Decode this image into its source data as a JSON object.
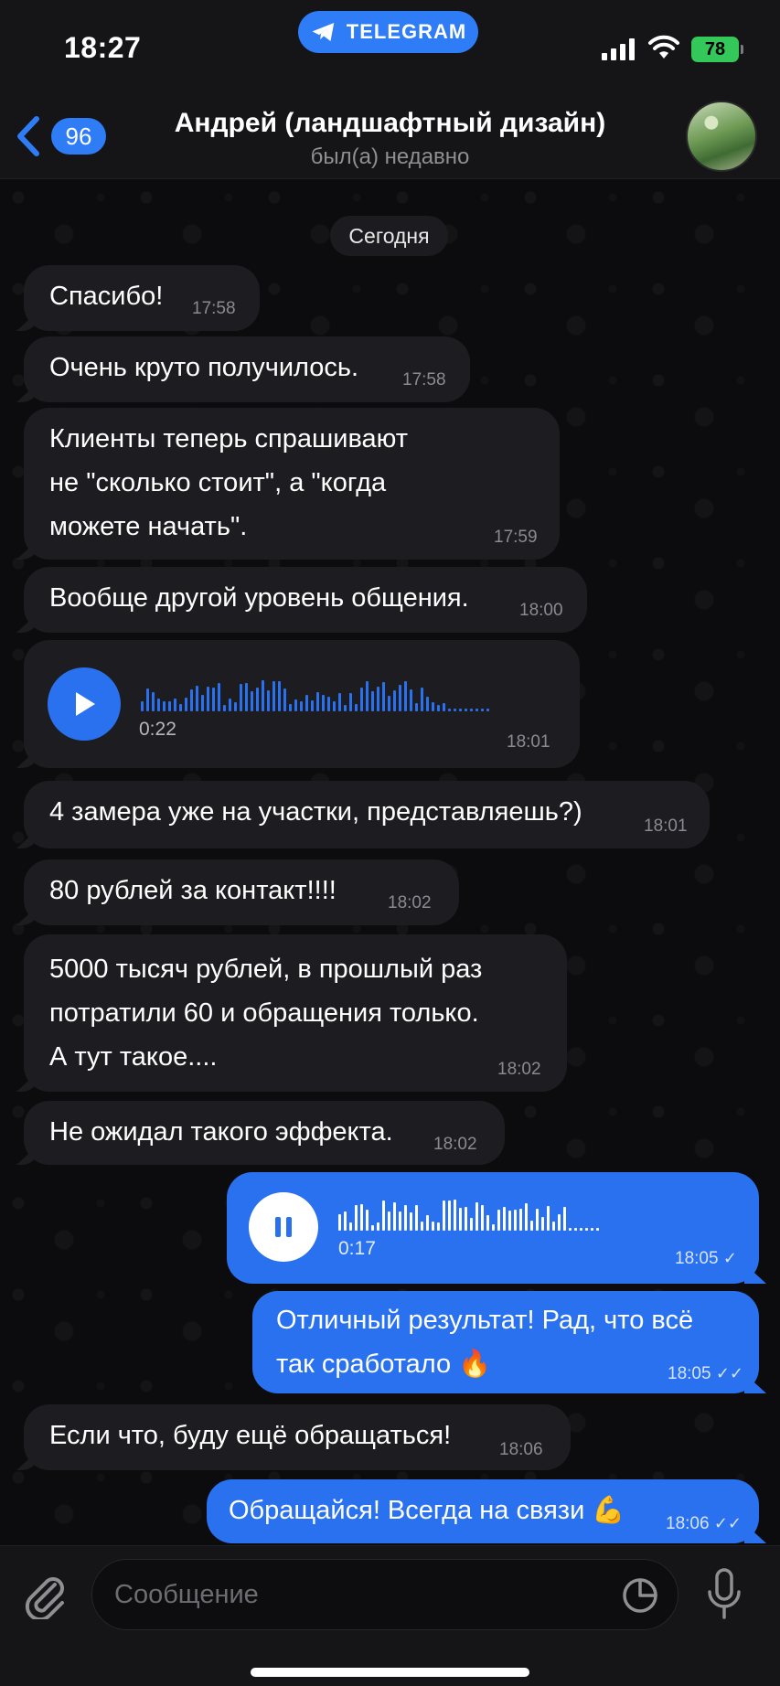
{
  "status": {
    "time": "18:27",
    "app_pill": "TELEGRAM",
    "battery": "78"
  },
  "header": {
    "back_count": "96",
    "contact_name": "Андрей (ландшафтный дизайн)",
    "last_seen": "был(а) недавно"
  },
  "date_label": "Сегодня",
  "messages": [
    {
      "text": "Спасибо!",
      "time": "17:58"
    },
    {
      "text": "Очень круто получилось.",
      "time": "17:58"
    },
    {
      "lines": [
        "Клиенты теперь спрашивают",
        "не \"сколько стоит\", а \"когда",
        "можете начать\"."
      ],
      "time": "17:59"
    },
    {
      "text": "Вообще другой уровень общения.",
      "time": "18:00"
    },
    {
      "voice_duration": "0:22",
      "time": "18:01"
    },
    {
      "text": "4 замера уже на участки, представляешь?)",
      "time": "18:01"
    },
    {
      "text": "80 рублей за контакт!!!!",
      "time": "18:02"
    },
    {
      "lines": [
        "5000 тысяч рублей, в прошлый раз",
        "потратили 60 и обращения только.",
        "А тут такое...."
      ],
      "time": "18:02"
    },
    {
      "text": "Не ожидал такого эффекта.",
      "time": "18:02"
    },
    {
      "voice_duration": "0:17",
      "time": "18:05"
    },
    {
      "lines": [
        "Отличный результат! Рад, что всё",
        "так сработало 🔥"
      ],
      "time": "18:05"
    },
    {
      "text": "Если что, буду ещё обращаться!",
      "time": "18:06"
    },
    {
      "text": "Обращайся! Всегда на связи 💪",
      "time": "18:06"
    }
  ],
  "composer": {
    "placeholder": "Сообщение"
  },
  "colors": {
    "accent": "#2a71f0",
    "incoming": "#1d1d21",
    "background": "#0b0b0d"
  }
}
